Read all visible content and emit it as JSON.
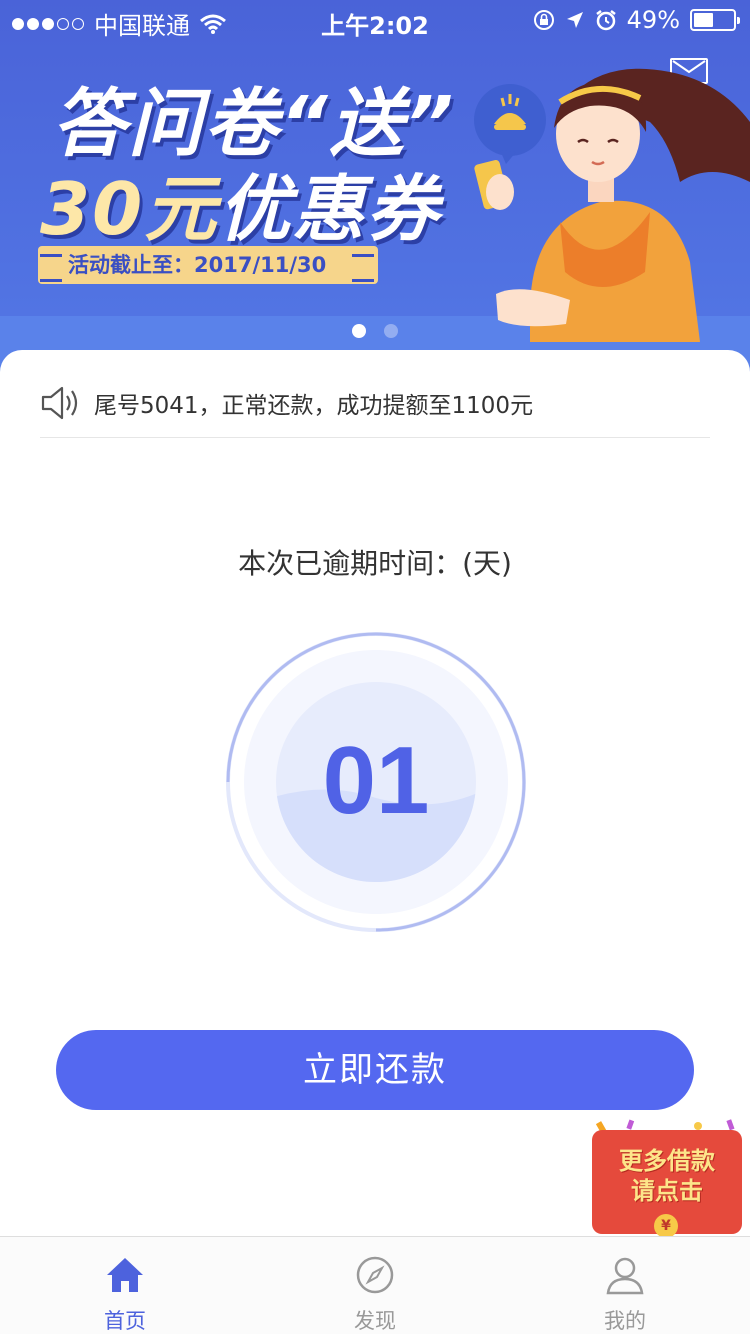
{
  "status_bar": {
    "carrier": "中国联通",
    "time": "上午2:02",
    "battery": "49%"
  },
  "banner": {
    "headline_line1": "答问卷“送”",
    "headline_amount": "30元",
    "headline_rest": "优惠券",
    "deadline": "活动截止至：2017/11/30",
    "page_count": 2,
    "active_page": 1
  },
  "notice": {
    "text": "尾号5041，正常还款，成功提额至1100元"
  },
  "overdue": {
    "label": "本次已逾期时间：(天)",
    "days": "01"
  },
  "repay_button": {
    "label": "立即还款"
  },
  "promo": {
    "line1": "更多借款",
    "line2": "请点击",
    "coin": "¥"
  },
  "tabs": [
    {
      "label": "首页",
      "icon": "home-icon",
      "active": true
    },
    {
      "label": "发现",
      "icon": "compass-icon",
      "active": false
    },
    {
      "label": "我的",
      "icon": "user-icon",
      "active": false
    }
  ],
  "colors": {
    "accent": "#5468f0",
    "banner": "#4a63d8",
    "promo_red": "#e54a3c"
  }
}
